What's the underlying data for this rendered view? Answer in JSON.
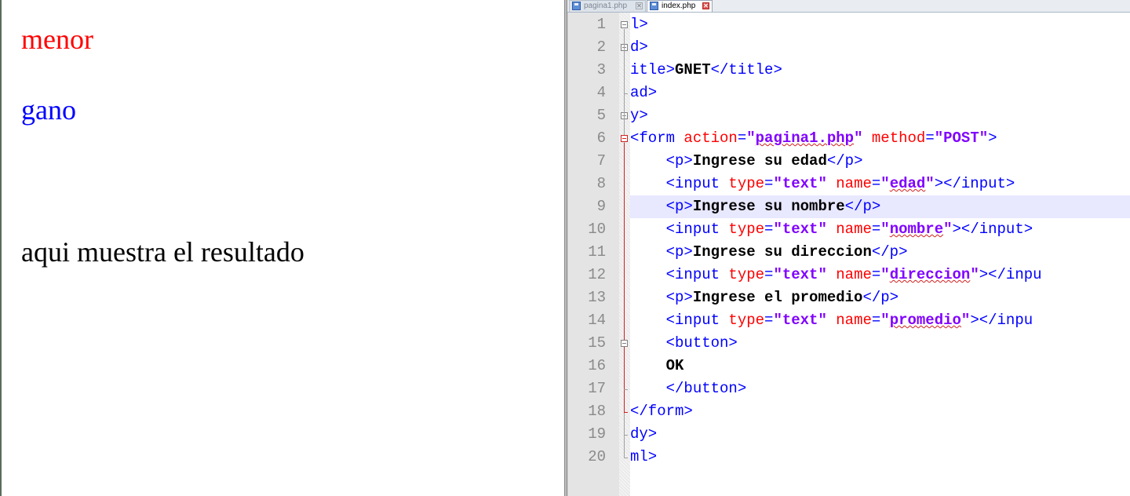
{
  "browser": {
    "lines": [
      {
        "text": "menor",
        "color": "#ff0000"
      },
      {
        "text": "gano",
        "color": "#0000ff"
      },
      {
        "text": "aqui muestra el resultado",
        "color": "#000000"
      }
    ]
  },
  "editor": {
    "tabs": [
      {
        "label": "pagina1.php",
        "active": false,
        "icon": "save-disk-icon"
      },
      {
        "label": "index.php",
        "active": true,
        "icon": "save-disk-icon"
      }
    ],
    "highlighted_line": 9,
    "line_numbers": [
      "1",
      "2",
      "3",
      "4",
      "5",
      "6",
      "7",
      "8",
      "9",
      "10",
      "11",
      "12",
      "13",
      "14",
      "15",
      "16",
      "17",
      "18",
      "19",
      "20"
    ],
    "code_lines": [
      [
        {
          "t": "l>",
          "c": "tag"
        }
      ],
      [
        {
          "t": "d>",
          "c": "tag"
        }
      ],
      [
        {
          "t": "itle>",
          "c": "tag"
        },
        {
          "t": "GNET",
          "c": "txt"
        },
        {
          "t": "</title>",
          "c": "tag"
        }
      ],
      [
        {
          "t": "ad>",
          "c": "tag"
        }
      ],
      [
        {
          "t": "y>",
          "c": "tag"
        }
      ],
      [
        {
          "t": "<form ",
          "c": "tag"
        },
        {
          "t": "action",
          "c": "attr"
        },
        {
          "t": "=",
          "c": "tag"
        },
        {
          "t": "\"",
          "c": "str"
        },
        {
          "t": "pagina1.php",
          "c": "str",
          "sq": true
        },
        {
          "t": "\"",
          "c": "str"
        },
        {
          "t": " ",
          "c": "tag"
        },
        {
          "t": "method",
          "c": "attr"
        },
        {
          "t": "=",
          "c": "tag"
        },
        {
          "t": "\"POST\"",
          "c": "str"
        },
        {
          "t": ">",
          "c": "tag"
        }
      ],
      [
        {
          "t": "    <p>",
          "c": "tag"
        },
        {
          "t": "Ingrese su edad",
          "c": "txt"
        },
        {
          "t": "</p>",
          "c": "tag"
        }
      ],
      [
        {
          "t": "    <input ",
          "c": "tag"
        },
        {
          "t": "type",
          "c": "attr"
        },
        {
          "t": "=",
          "c": "tag"
        },
        {
          "t": "\"text\"",
          "c": "str"
        },
        {
          "t": " ",
          "c": "tag"
        },
        {
          "t": "name",
          "c": "attr"
        },
        {
          "t": "=",
          "c": "tag"
        },
        {
          "t": "\"",
          "c": "str"
        },
        {
          "t": "edad",
          "c": "str",
          "sq": true
        },
        {
          "t": "\"",
          "c": "str"
        },
        {
          "t": "></input>",
          "c": "tag"
        }
      ],
      [
        {
          "t": "    <p>",
          "c": "tag"
        },
        {
          "t": "Ingrese su nombre",
          "c": "txt"
        },
        {
          "t": "</p>",
          "c": "tag"
        }
      ],
      [
        {
          "t": "    <input ",
          "c": "tag"
        },
        {
          "t": "type",
          "c": "attr"
        },
        {
          "t": "=",
          "c": "tag"
        },
        {
          "t": "\"text\"",
          "c": "str"
        },
        {
          "t": " ",
          "c": "tag"
        },
        {
          "t": "name",
          "c": "attr"
        },
        {
          "t": "=",
          "c": "tag"
        },
        {
          "t": "\"",
          "c": "str"
        },
        {
          "t": "nombre",
          "c": "str",
          "sq": true
        },
        {
          "t": "\"",
          "c": "str"
        },
        {
          "t": "></input>",
          "c": "tag"
        }
      ],
      [
        {
          "t": "    <p>",
          "c": "tag"
        },
        {
          "t": "Ingrese su direccion",
          "c": "txt"
        },
        {
          "t": "</p>",
          "c": "tag"
        }
      ],
      [
        {
          "t": "    <input ",
          "c": "tag"
        },
        {
          "t": "type",
          "c": "attr"
        },
        {
          "t": "=",
          "c": "tag"
        },
        {
          "t": "\"text\"",
          "c": "str"
        },
        {
          "t": " ",
          "c": "tag"
        },
        {
          "t": "name",
          "c": "attr"
        },
        {
          "t": "=",
          "c": "tag"
        },
        {
          "t": "\"",
          "c": "str"
        },
        {
          "t": "direccion",
          "c": "str",
          "sq": true
        },
        {
          "t": "\"",
          "c": "str"
        },
        {
          "t": "></inpu",
          "c": "tag"
        }
      ],
      [
        {
          "t": "    <p>",
          "c": "tag"
        },
        {
          "t": "Ingrese el promedio",
          "c": "txt"
        },
        {
          "t": "</p>",
          "c": "tag"
        }
      ],
      [
        {
          "t": "    <input ",
          "c": "tag"
        },
        {
          "t": "type",
          "c": "attr"
        },
        {
          "t": "=",
          "c": "tag"
        },
        {
          "t": "\"text\"",
          "c": "str"
        },
        {
          "t": " ",
          "c": "tag"
        },
        {
          "t": "name",
          "c": "attr"
        },
        {
          "t": "=",
          "c": "tag"
        },
        {
          "t": "\"",
          "c": "str"
        },
        {
          "t": "promedio",
          "c": "str",
          "sq": true
        },
        {
          "t": "\"",
          "c": "str"
        },
        {
          "t": "></inpu",
          "c": "tag"
        }
      ],
      [
        {
          "t": "    <button>",
          "c": "tag"
        }
      ],
      [
        {
          "t": "    OK",
          "c": "txt"
        }
      ],
      [
        {
          "t": "    </button>",
          "c": "tag"
        }
      ],
      [
        {
          "t": "</form>",
          "c": "tag"
        }
      ],
      [
        {
          "t": "dy>",
          "c": "tag"
        }
      ],
      [
        {
          "t": "ml>",
          "c": "tag"
        }
      ]
    ]
  },
  "colors": {
    "tag": "#0000ff",
    "attribute": "#ff0000",
    "string": "#8000ff",
    "text": "#000000",
    "line_number": "#8a8a8a",
    "current_line": "#e8e8ff"
  }
}
